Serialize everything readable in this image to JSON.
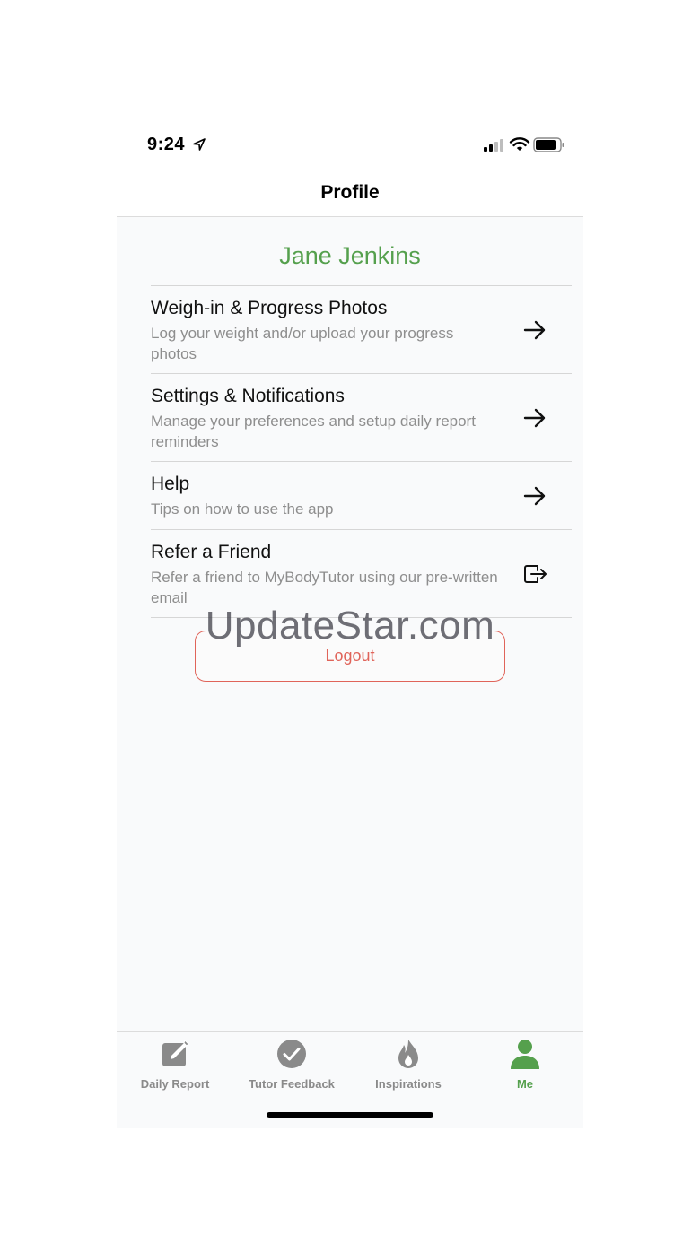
{
  "status_bar": {
    "time": "9:24",
    "location_icon": "location-arrow-icon",
    "signal_icon": "cellular-signal-icon",
    "wifi_icon": "wifi-icon",
    "battery_icon": "battery-icon"
  },
  "nav": {
    "title": "Profile"
  },
  "profile": {
    "name": "Jane Jenkins",
    "name_color": "#55a04d"
  },
  "menu": {
    "items": [
      {
        "title": "Weigh-in & Progress Photos",
        "subtitle": "Log your weight and/or upload your progress photos",
        "icon": "arrow-right-icon"
      },
      {
        "title": "Settings & Notifications",
        "subtitle": "Manage your preferences and setup daily report reminders",
        "icon": "arrow-right-icon"
      },
      {
        "title": "Help",
        "subtitle": "Tips on how to use the app",
        "icon": "arrow-right-icon"
      },
      {
        "title": "Refer a Friend",
        "subtitle": "Refer a friend to MyBodyTutor using our pre-written email",
        "icon": "share-out-icon"
      }
    ]
  },
  "logout": {
    "label": "Logout",
    "color": "#e0645a"
  },
  "watermark": {
    "text": "UpdateStar.com"
  },
  "tabs": [
    {
      "label": "Daily Report",
      "icon": "edit-note-icon",
      "active": false
    },
    {
      "label": "Tutor Feedback",
      "icon": "checkmark-circle-icon",
      "active": false
    },
    {
      "label": "Inspirations",
      "icon": "flame-icon",
      "active": false
    },
    {
      "label": "Me",
      "icon": "person-icon",
      "active": true
    }
  ],
  "colors": {
    "accent": "#55a04d",
    "inactive_tab": "#8a8a8a",
    "danger": "#e0645a"
  }
}
